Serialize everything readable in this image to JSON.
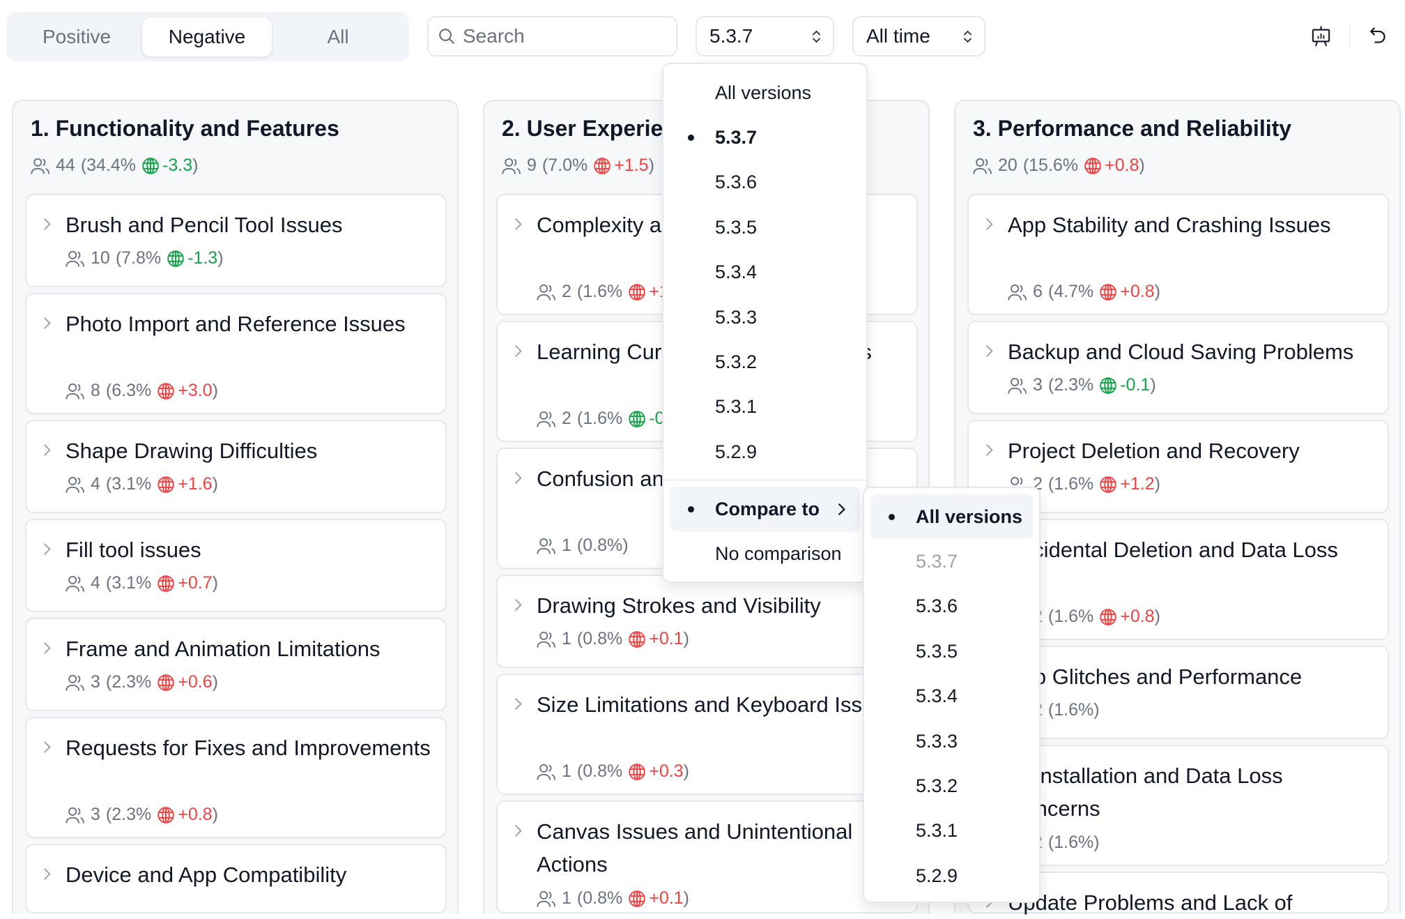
{
  "filter_tabs": [
    {
      "label": "Positive",
      "active": false
    },
    {
      "label": "Negative",
      "active": true
    },
    {
      "label": "All",
      "active": false
    }
  ],
  "search": {
    "placeholder": "Search",
    "value": ""
  },
  "version_select": {
    "value": "5.3.7"
  },
  "time_select": {
    "value": "All time"
  },
  "toolbar": {
    "icons": [
      "presentation-chart-icon",
      "undo-icon"
    ]
  },
  "colors": {
    "positive": "#16a34a",
    "negative": "#ef4444",
    "muted": "#6b7280"
  },
  "columns": [
    {
      "title": "1. Functionality and Features",
      "count": "44",
      "pct": "(34.4%",
      "delta": "-3.3",
      "dir": "pos",
      "close": ")",
      "cards": [
        {
          "title": "Brush and Pencil Tool Issues",
          "count": "10",
          "pct": "(7.8%",
          "delta": "-1.3",
          "dir": "pos",
          "close": ")"
        },
        {
          "title": "Photo Import and Reference Issues",
          "count": "8",
          "pct": "(6.3%",
          "delta": "+3.0",
          "dir": "neg",
          "close": ")"
        },
        {
          "title": "Shape Drawing Difficulties",
          "count": "4",
          "pct": "(3.1%",
          "delta": "+1.6",
          "dir": "neg",
          "close": ")"
        },
        {
          "title": "Fill tool issues",
          "count": "4",
          "pct": "(3.1%",
          "delta": "+0.7",
          "dir": "neg",
          "close": ")"
        },
        {
          "title": "Frame and Animation Limitations",
          "count": "3",
          "pct": "(2.3%",
          "delta": "+0.6",
          "dir": "neg",
          "close": ")"
        },
        {
          "title": "Requests for Fixes and Improvements",
          "count": "3",
          "pct": "(2.3%",
          "delta": "+0.8",
          "dir": "neg",
          "close": ")"
        },
        {
          "title": "Device and App Compatibility",
          "count": "",
          "pct": "",
          "delta": "",
          "dir": "",
          "close": ""
        }
      ]
    },
    {
      "title": "2. User Experience",
      "count": "9",
      "pct": "(7.0%",
      "delta": "+1.5",
      "dir": "neg",
      "close": ")",
      "cards": [
        {
          "title": "Complexity and Usability Issues",
          "count": "2",
          "pct": "(1.6%",
          "delta": "+1.0",
          "dir": "neg",
          "close": ")"
        },
        {
          "title": "Learning Curve and Tutorial Needs",
          "count": "2",
          "pct": "(1.6%",
          "delta": "-0.1",
          "dir": "pos",
          "close": ")"
        },
        {
          "title": "Confusion and Navigation in App",
          "count": "1",
          "pct": "(0.8%)",
          "delta": "",
          "dir": "",
          "close": ""
        },
        {
          "title": "Drawing Strokes and Visibility",
          "count": "1",
          "pct": "(0.8%",
          "delta": "+0.1",
          "dir": "neg",
          "close": ")"
        },
        {
          "title": "Size Limitations and Keyboard Issues",
          "count": "1",
          "pct": "(0.8%",
          "delta": "+0.3",
          "dir": "neg",
          "close": ")"
        },
        {
          "title": "Canvas Issues and Unintentional Actions",
          "count": "1",
          "pct": "(0.8%",
          "delta": "+0.1",
          "dir": "neg",
          "close": ")"
        }
      ]
    },
    {
      "title": "3. Performance and Reliability",
      "count": "20",
      "pct": "(15.6%",
      "delta": "+0.8",
      "dir": "neg",
      "close": ")",
      "cards": [
        {
          "title": "App Stability and Crashing Issues",
          "count": "6",
          "pct": "(4.7%",
          "delta": "+0.8",
          "dir": "neg",
          "close": ")"
        },
        {
          "title": "Backup and Cloud Saving Problems",
          "count": "3",
          "pct": "(2.3%",
          "delta": "-0.1",
          "dir": "pos",
          "close": ")"
        },
        {
          "title": "Project Deletion and Recovery",
          "count": "2",
          "pct": "(1.6%",
          "delta": "+1.2",
          "dir": "neg",
          "close": ")"
        },
        {
          "title": "Accidental Deletion and Data Loss",
          "count": "2",
          "pct": "(1.6%",
          "delta": "+0.8",
          "dir": "neg",
          "close": ")"
        },
        {
          "title": "App Glitches and Performance",
          "count": "2",
          "pct": "(1.6%)",
          "delta": "",
          "dir": "",
          "close": ""
        },
        {
          "title": "Reinstallation and Data Loss Concerns",
          "count": "2",
          "pct": "(1.6%)",
          "delta": "",
          "dir": "",
          "close": ""
        },
        {
          "title": "Update Problems and Lack of",
          "count": "",
          "pct": "",
          "delta": "",
          "dir": "",
          "close": ""
        }
      ]
    }
  ],
  "version_menu": {
    "items": [
      {
        "label": "All versions",
        "selected": false
      },
      {
        "label": "5.3.7",
        "selected": true
      },
      {
        "label": "5.3.6",
        "selected": false
      },
      {
        "label": "5.3.5",
        "selected": false
      },
      {
        "label": "5.3.4",
        "selected": false
      },
      {
        "label": "5.3.3",
        "selected": false
      },
      {
        "label": "5.3.2",
        "selected": false
      },
      {
        "label": "5.3.1",
        "selected": false
      },
      {
        "label": "5.2.9",
        "selected": false
      }
    ],
    "compare_label": "Compare to",
    "no_comparison_label": "No comparison"
  },
  "compare_menu": {
    "items": [
      {
        "label": "All versions",
        "selected": true,
        "disabled": false
      },
      {
        "label": "5.3.7",
        "selected": false,
        "disabled": true
      },
      {
        "label": "5.3.6",
        "selected": false,
        "disabled": false
      },
      {
        "label": "5.3.5",
        "selected": false,
        "disabled": false
      },
      {
        "label": "5.3.4",
        "selected": false,
        "disabled": false
      },
      {
        "label": "5.3.3",
        "selected": false,
        "disabled": false
      },
      {
        "label": "5.3.2",
        "selected": false,
        "disabled": false
      },
      {
        "label": "5.3.1",
        "selected": false,
        "disabled": false
      },
      {
        "label": "5.2.9",
        "selected": false,
        "disabled": false
      }
    ]
  }
}
